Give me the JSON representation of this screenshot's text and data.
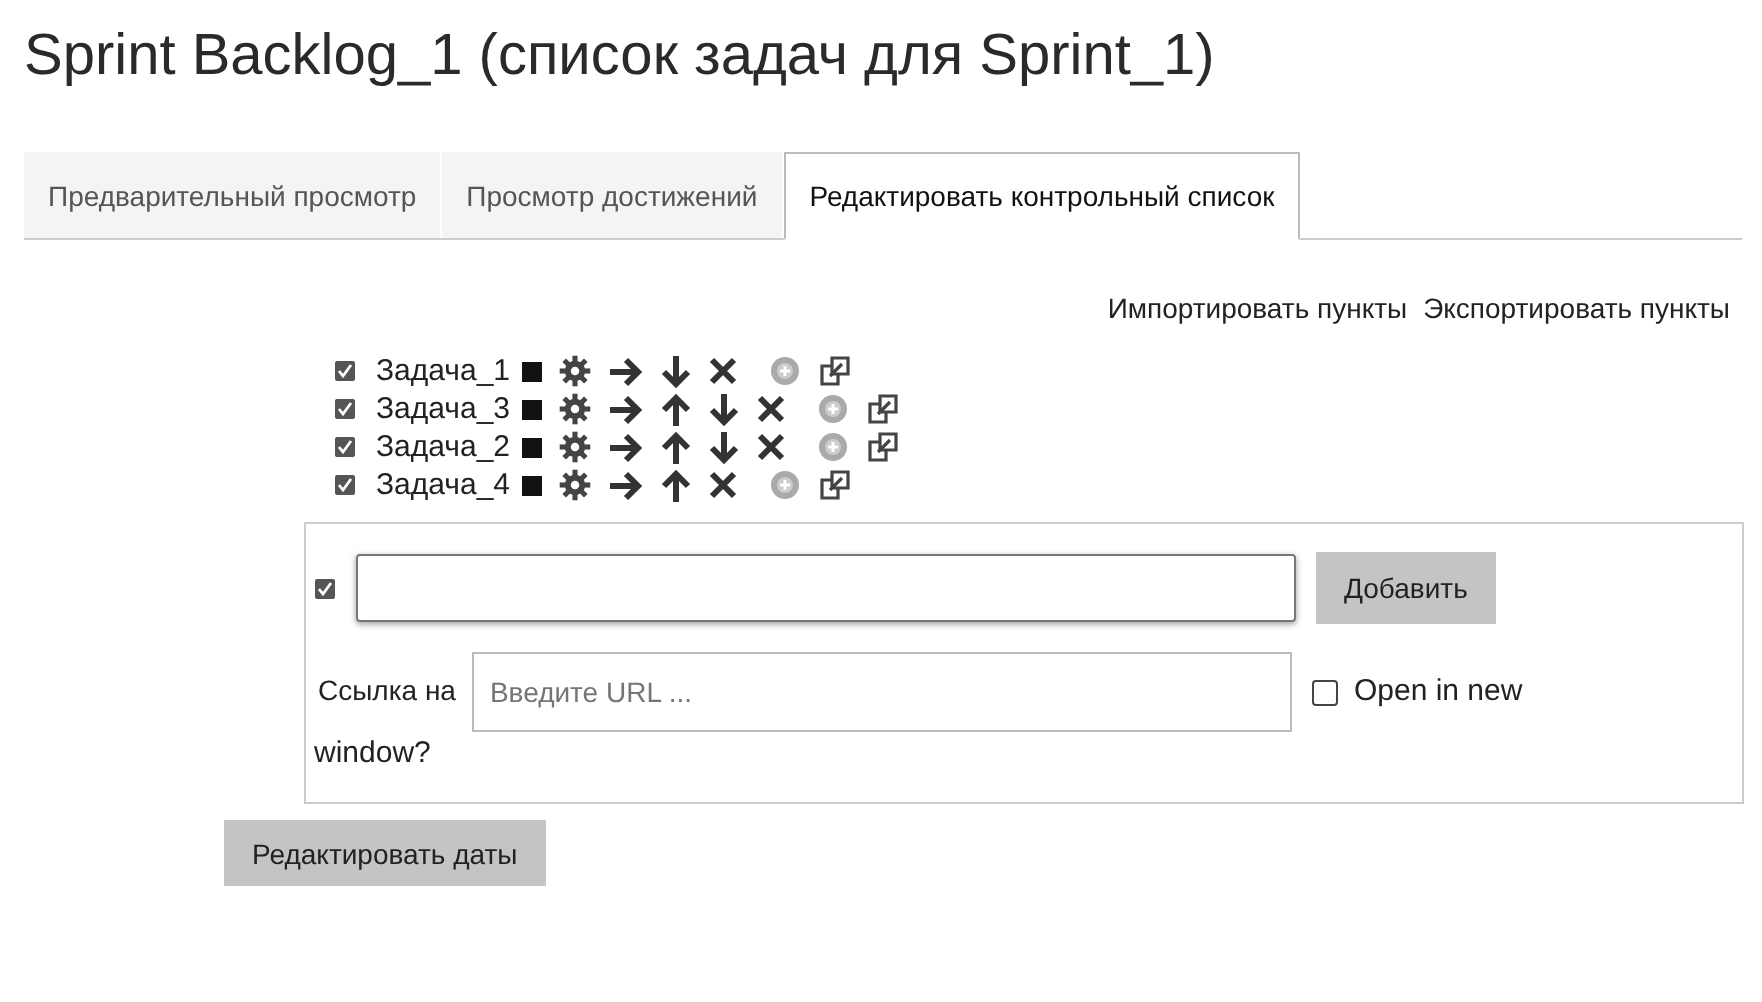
{
  "title": "Sprint Backlog_1 (список задач для Sprint_1)",
  "tabs": [
    {
      "label": "Предварительный просмотр",
      "selected": false
    },
    {
      "label": "Просмотр достижений",
      "selected": false
    },
    {
      "label": "Редактировать контрольный список",
      "selected": true
    }
  ],
  "links": [
    "Импортировать пункты",
    "Экспортировать пункты"
  ],
  "tasks": [
    {
      "name": "Задача_1",
      "actions": [
        {
          "kind": "color"
        },
        {
          "kind": "edit"
        },
        {
          "kind": "indent"
        },
        {
          "kind": "down"
        },
        {
          "kind": "delete"
        },
        {
          "kind": "add"
        },
        {
          "kind": "link"
        }
      ]
    },
    {
      "name": "Задача_3",
      "actions": [
        {
          "kind": "color"
        },
        {
          "kind": "edit"
        },
        {
          "kind": "indent"
        },
        {
          "kind": "up"
        },
        {
          "kind": "down"
        },
        {
          "kind": "delete"
        },
        {
          "kind": "add"
        },
        {
          "kind": "link"
        }
      ]
    },
    {
      "name": "Задача_2",
      "actions": [
        {
          "kind": "color"
        },
        {
          "kind": "edit"
        },
        {
          "kind": "indent"
        },
        {
          "kind": "up"
        },
        {
          "kind": "down"
        },
        {
          "kind": "delete"
        },
        {
          "kind": "add"
        },
        {
          "kind": "link"
        }
      ]
    },
    {
      "name": "Задача_4",
      "actions": [
        {
          "kind": "color"
        },
        {
          "kind": "edit"
        },
        {
          "kind": "indent"
        },
        {
          "kind": "up"
        },
        {
          "kind": "delete"
        },
        {
          "kind": "add"
        },
        {
          "kind": "link"
        }
      ]
    }
  ],
  "form": {
    "add_button": "Добавить",
    "url_label": "Ссылка на",
    "url_placeholder": "Введите URL ...",
    "new_window": {
      "label": "Open in new",
      "label_wrapped": "window?",
      "checked": false
    }
  },
  "edit_dates_button": "Редактировать даты"
}
